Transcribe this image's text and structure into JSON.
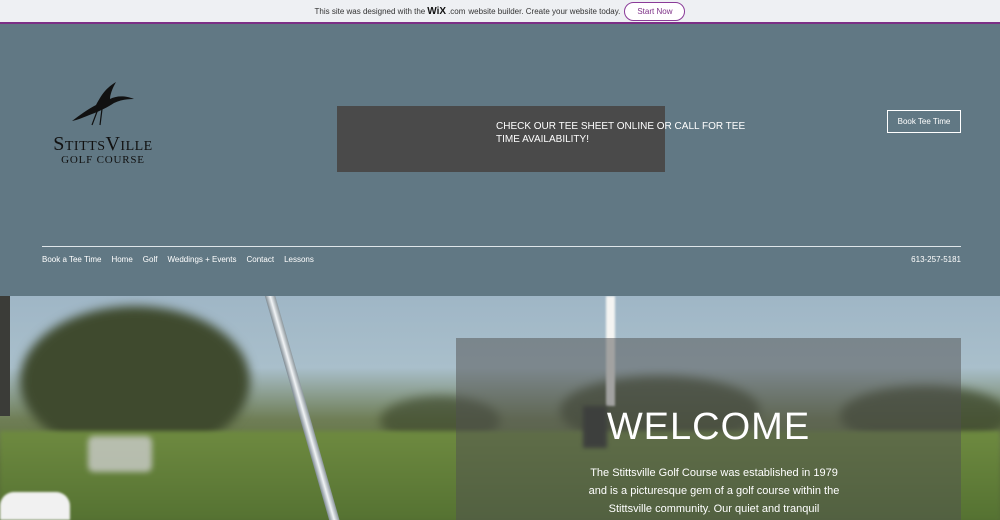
{
  "wix_banner": {
    "text_before": "This site was designed with the",
    "brand": "WiX",
    "dotcom": ".com",
    "text_after": "website builder. Create your website today.",
    "button": "Start Now"
  },
  "logo": {
    "title": "StittsVille",
    "subtitle": "GOLF COURSE"
  },
  "notice": {
    "text": "CHECK OUR TEE SHEET ONLINE OR CALL FOR TEE TIME AVAILABILITY!"
  },
  "header": {
    "book_button": "Book Tee Time",
    "phone": "613-257-5181"
  },
  "nav": {
    "items": [
      "Book a Tee Time",
      "Home",
      "Golf",
      "Weddings + Events",
      "Contact",
      "Lessons"
    ]
  },
  "hero": {
    "title": "WELCOME",
    "body": "The Stittsville Golf Course was established in 1979 and is a picturesque gem of a golf course within the Stittsville community.  Our quiet and tranquil"
  },
  "colors": {
    "header_bg": "#617884",
    "banner_accent": "#7c2f86",
    "notice_bg": "#4a4a4a"
  }
}
